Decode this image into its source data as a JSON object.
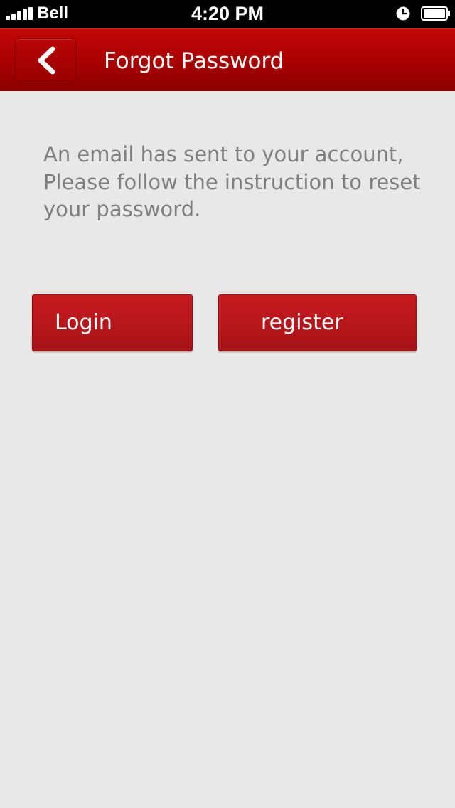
{
  "status_bar": {
    "carrier": "Bell",
    "time": "4:20 PM",
    "icons": [
      "signal-icon",
      "alarm-icon",
      "battery-icon"
    ]
  },
  "nav": {
    "title": "Forgot Password",
    "back_icon": "chevron-left-icon"
  },
  "message": "An email has sent to your account, Please follow the instruction to reset your password.",
  "buttons": {
    "login_label": "Login",
    "register_label": "register"
  },
  "colors": {
    "nav_bar": "#a80000",
    "button": "#b5161b",
    "background": "#e8e8e8",
    "message_text": "#7f7f7f"
  }
}
